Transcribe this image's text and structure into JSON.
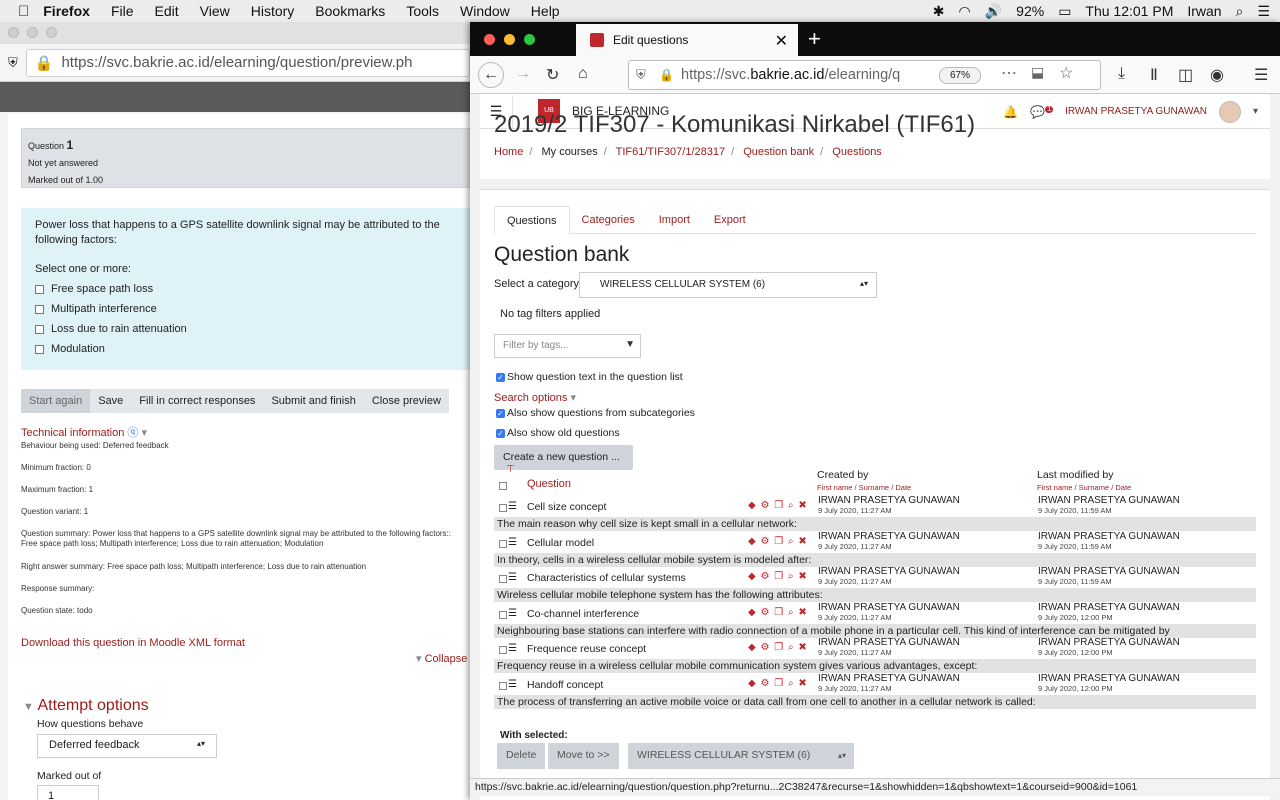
{
  "menubar": {
    "app": "Firefox",
    "items": [
      "File",
      "Edit",
      "View",
      "History",
      "Bookmarks",
      "Tools",
      "Window",
      "Help"
    ],
    "battery": "92%",
    "clock": "Thu 12:01 PM",
    "user": "Irwan"
  },
  "back": {
    "url": "https://svc.bakrie.ac.id/elearning/question/preview.ph",
    "question_label": "Question",
    "question_number": "1",
    "status": "Not yet answered",
    "marked": "Marked out of 1.00",
    "qtext": "Power loss that happens to a GPS satellite downlink signal may be attributed to the following factors:",
    "select_prompt": "Select one or more:",
    "options": [
      "Free space path loss",
      "Multipath interference",
      "Loss due to rain attenuation",
      "Modulation"
    ],
    "buttons": [
      "Start again",
      "Save",
      "Fill in correct responses",
      "Submit and finish",
      "Close preview"
    ],
    "tech_title": "Technical information",
    "tech_lines": [
      "Behaviour being used: Deferred feedback",
      "Minimum fraction: 0",
      "Maximum fraction: 1",
      "Question variant: 1",
      "Question summary: Power loss that happens to a GPS satellite downlink signal may be attributed to the following factors:: Free space path loss; Multipath interference; Loss due to rain attenuation; Modulation",
      "Right answer summary: Free space path loss; Multipath interference; Loss due to rain attenuation",
      "Response summary:",
      "Question state: todo"
    ],
    "download": "Download this question in Moodle XML format",
    "collapse": "Collapse",
    "attempt_title": "Attempt options",
    "behave_label": "How questions behave",
    "behave_value": "Deferred feedback",
    "marked_label": "Marked out of",
    "marked_value": "1"
  },
  "front": {
    "tab_title": "Edit questions",
    "url_pre": "https://svc.",
    "url_host": "bakrie.ac.id",
    "url_post": "/elearning/q",
    "zoom": "67%",
    "site_name": "BIG E-LEARNING",
    "user_name": "IRWAN PRASETYA GUNAWAN",
    "notif_count": "1",
    "course_title": "2019/2 TIF307 - Komunikasi Nirkabel (TIF61)",
    "breadcrumb": [
      "Home",
      "My courses",
      "TIF61/TIF307/1/28317",
      "Question bank",
      "Questions"
    ],
    "tabs": [
      "Questions",
      "Categories",
      "Import",
      "Export"
    ],
    "heading": "Question bank",
    "cat_label": "Select a category:",
    "cat_value": "WIRELESS CELLULAR SYSTEM (6)",
    "no_tag": "No tag filters applied",
    "filter_placeholder": "Filter by tags...",
    "show_text": "Show question text in the question list",
    "search_options": "Search options",
    "sub_cats": "Also show questions from subcategories",
    "old_q": "Also show old questions",
    "create_btn": "Create a new question ...",
    "col_question": "Question",
    "col_created": "Created by",
    "col_modified": "Last modified by",
    "col_sub": "First name / Surname / Date",
    "with_selected": "With selected:",
    "delete_btn": "Delete",
    "move_btn": "Move to >>",
    "move_target": "WIRELESS CELLULAR SYSTEM (6)",
    "status_url": "https://svc.bakrie.ac.id/elearning/question/question.php?returnu...2C38247&recurse=1&showhidden=1&qbshowtext=1&courseid=900&id=1061"
  },
  "questions": [
    {
      "name": "Cell size concept",
      "creator": "IRWAN PRASETYA GUNAWAN",
      "created": "9 July 2020, 11:27 AM",
      "modifier": "IRWAN PRASETYA GUNAWAN",
      "modified": "9 July 2020, 11:59 AM",
      "text": "The main reason why cell size is kept small in a cellular network:"
    },
    {
      "name": "Cellular model",
      "creator": "IRWAN PRASETYA GUNAWAN",
      "created": "9 July 2020, 11:27 AM",
      "modifier": "IRWAN PRASETYA GUNAWAN",
      "modified": "9 July 2020, 11:59 AM",
      "text": "In theory, cells in a wireless cellular mobile system is modeled after:"
    },
    {
      "name": "Characteristics of cellular systems",
      "creator": "IRWAN PRASETYA GUNAWAN",
      "created": "9 July 2020, 11:27 AM",
      "modifier": "IRWAN PRASETYA GUNAWAN",
      "modified": "9 July 2020, 11:59 AM",
      "text": "Wireless cellular mobile telephone system has the following attributes:"
    },
    {
      "name": "Co-channel interference",
      "creator": "IRWAN PRASETYA GUNAWAN",
      "created": "9 July 2020, 11:27 AM",
      "modifier": "IRWAN PRASETYA GUNAWAN",
      "modified": "9 July 2020, 12:00 PM",
      "text": "Neighbouring base stations can interfere with radio connection of a mobile phone in a particular cell. This kind of interference can be mitigated by"
    },
    {
      "name": "Frequence reuse concept",
      "creator": "IRWAN PRASETYA GUNAWAN",
      "created": "9 July 2020, 11:27 AM",
      "modifier": "IRWAN PRASETYA GUNAWAN",
      "modified": "9 July 2020, 12:00 PM",
      "text": "Frequency reuse in a wireless cellular mobile communication system gives various advantages, except:"
    },
    {
      "name": "Handoff concept",
      "creator": "IRWAN PRASETYA GUNAWAN",
      "created": "9 July 2020, 11:27 AM",
      "modifier": "IRWAN PRASETYA GUNAWAN",
      "modified": "9 July 2020, 12:00 PM",
      "text": "The process of transferring an active mobile voice or data call from one cell to another in a cellular network is called:"
    }
  ]
}
